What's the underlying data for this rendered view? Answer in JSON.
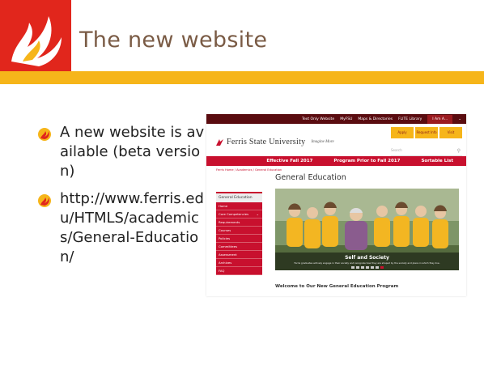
{
  "slide": {
    "title": "The new website",
    "colors": {
      "accent_red": "#e1261c",
      "accent_gold": "#f6b51a",
      "title_text": "#7a5b45"
    },
    "bullets": [
      {
        "icon": "flame-bullet-icon",
        "text": "A new website is available (beta version)"
      },
      {
        "icon": "flame-bullet-icon",
        "text": "http://www.ferris.edu/HTMLS/academics/General-Education/"
      }
    ]
  },
  "website": {
    "topbar": {
      "links": [
        "Text Only Website",
        "MyFSU",
        "Maps & Directories",
        "FLITE Library"
      ],
      "i_am": "I Am A...",
      "chevron": "chevron-down-icon"
    },
    "brand": {
      "name": "Ferris State University",
      "tagline": "Imagine More",
      "logo_icon": "ferris-flame-logo"
    },
    "quick_links": [
      "Apply",
      "Request Info",
      "Visit"
    ],
    "search_placeholder": "Search",
    "redbar": [
      "Effective Fall 2017",
      "Program Prior to Fall 2017",
      "Sortable List"
    ],
    "breadcrumb": "Ferris Home / Academics / General Education",
    "page_heading": "General Education",
    "sidenav": {
      "title": "General Education",
      "items": [
        "Home",
        "Core Competencies",
        "Requirements",
        "Courses",
        "Policies",
        "Committees",
        "Assessment",
        "Archives",
        "FAQ"
      ]
    },
    "hero": {
      "caption_title": "Self and Society",
      "caption_sub": "Ferris graduates actively engage in their society and recognize how they are shaped by the society and place in which they live.",
      "slides": 7,
      "active_slide": 1
    },
    "welcome": "Welcome to Our New General Education Program"
  }
}
